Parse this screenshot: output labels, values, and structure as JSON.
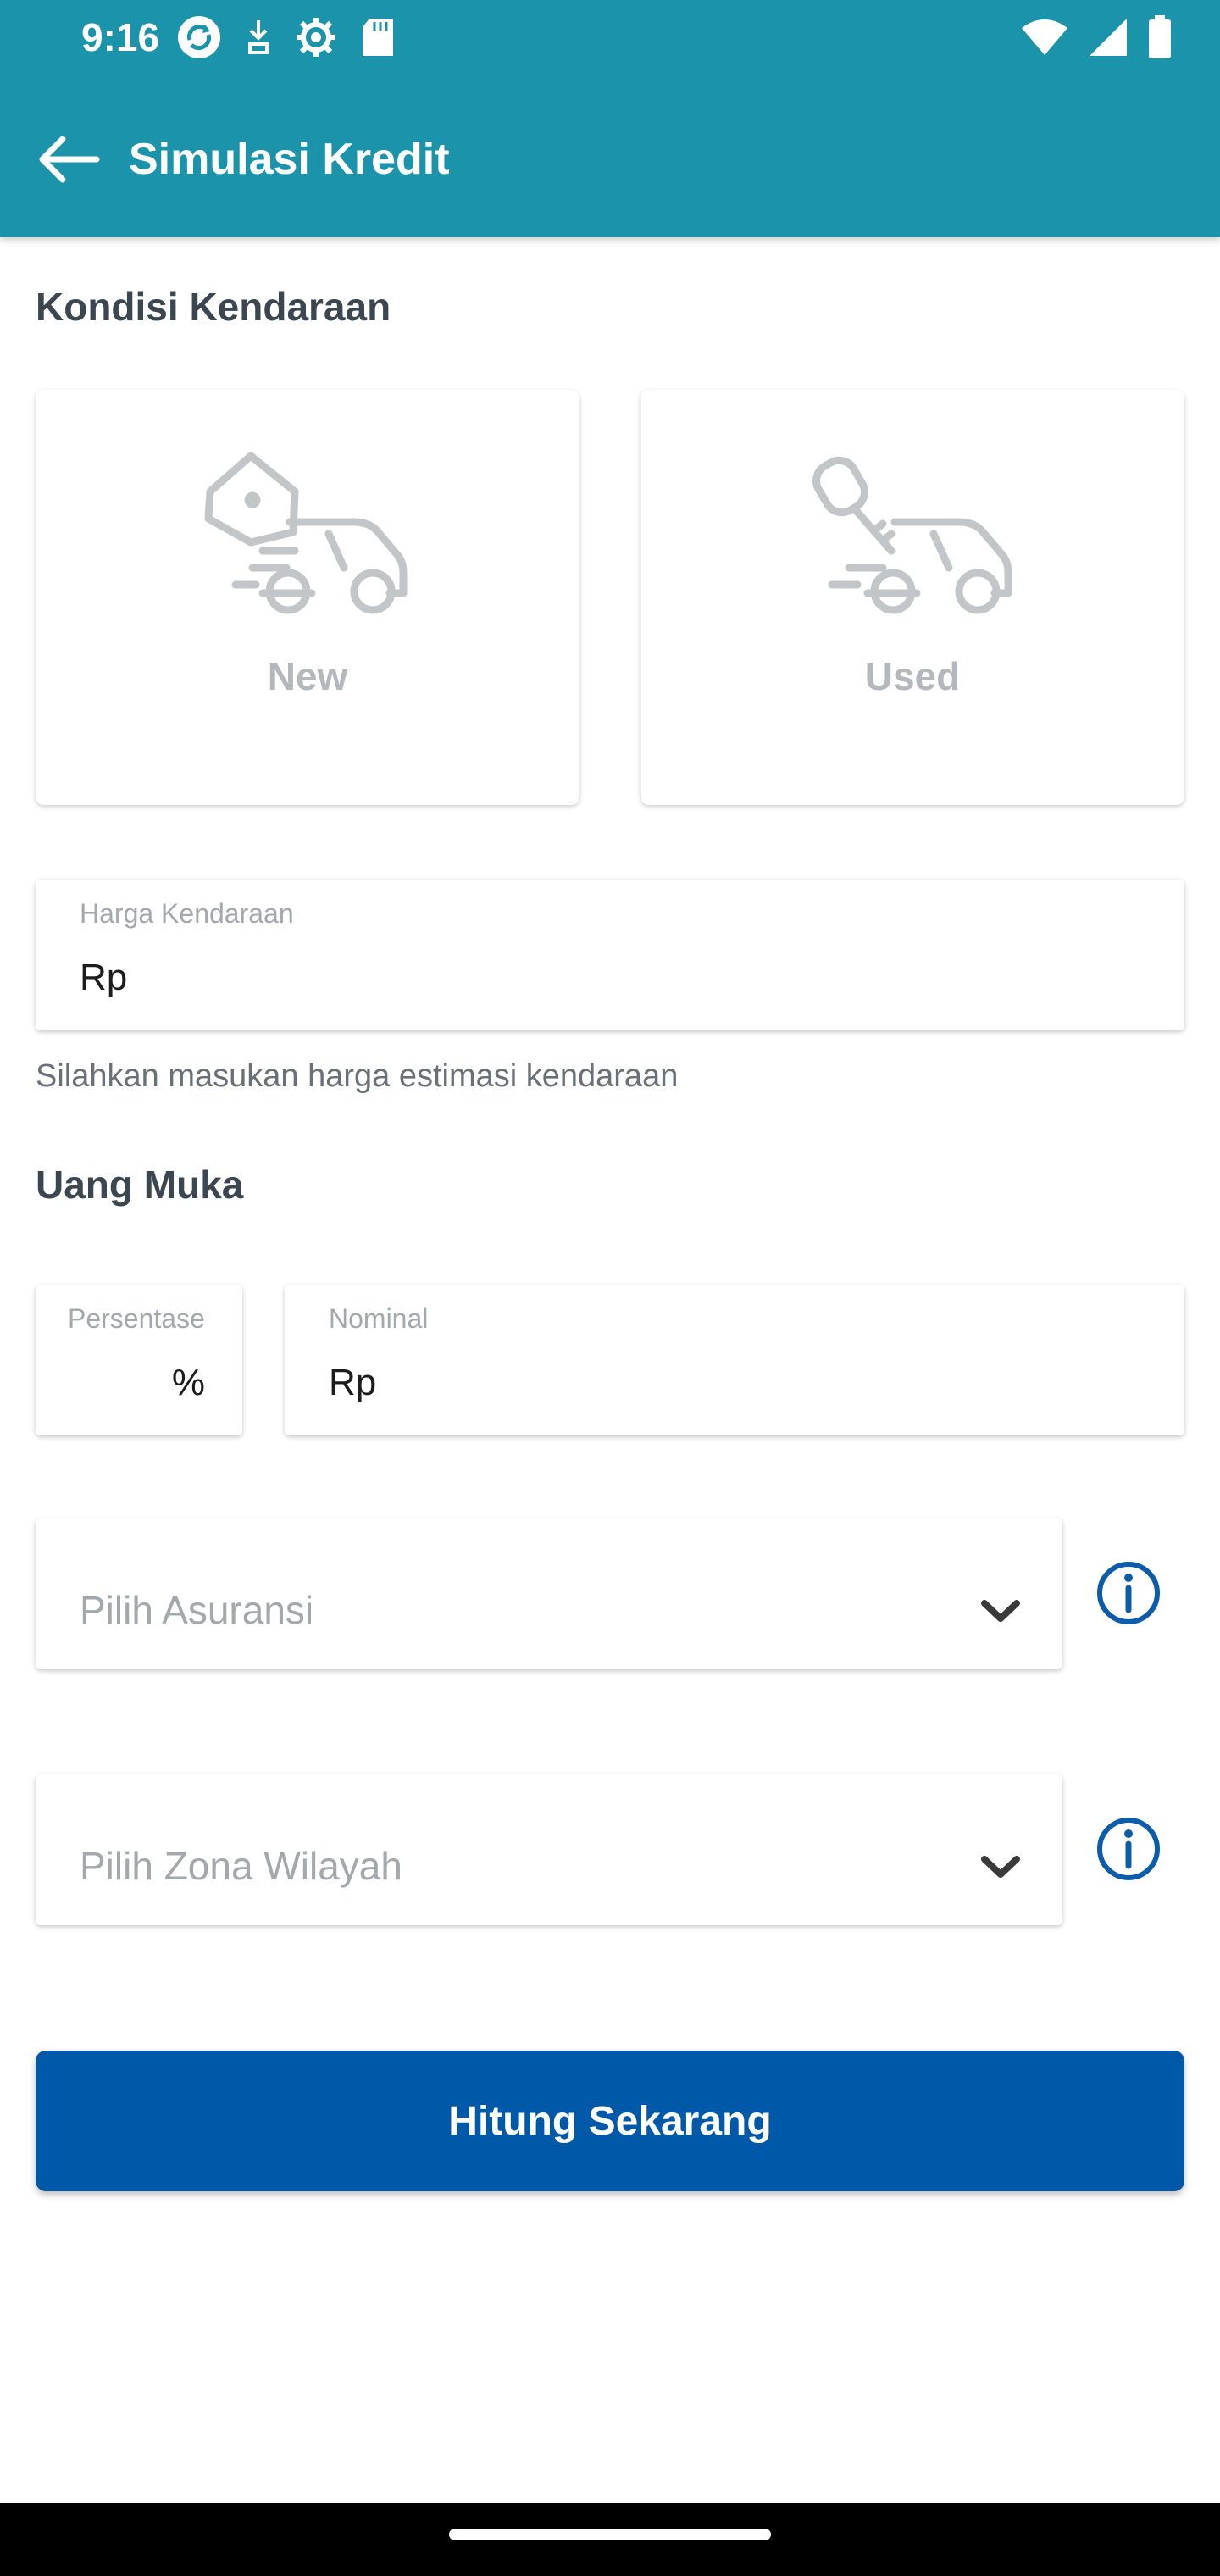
{
  "status_bar": {
    "time": "9:16",
    "left_icons": [
      "sync-icon",
      "download-icon",
      "settings-icon",
      "sd-card-icon"
    ],
    "right_icons": [
      "wifi-icon",
      "signal-icon",
      "battery-icon"
    ]
  },
  "appbar": {
    "title": "Simulasi Kredit",
    "back_icon": "arrow-left-icon",
    "color": "#1a93ab"
  },
  "vehicle_condition": {
    "title": "Kondisi Kendaraan",
    "options": [
      {
        "label": "New",
        "icon": "car-tag-icon"
      },
      {
        "label": "Used",
        "icon": "car-key-icon"
      }
    ]
  },
  "price_field": {
    "label": "Harga Kendaraan",
    "prefix": "Rp",
    "value": "",
    "helper": "Silahkan masukan harga estimasi kendaraan"
  },
  "down_payment": {
    "title": "Uang Muka",
    "percentage": {
      "label": "Persentase",
      "suffix": "%",
      "value": ""
    },
    "nominal": {
      "label": "Nominal",
      "prefix": "Rp",
      "value": ""
    }
  },
  "insurance_select": {
    "placeholder": "Pilih Asuransi",
    "info_icon": "info-icon"
  },
  "zone_select": {
    "placeholder": "Pilih Zona Wilayah",
    "info_icon": "info-icon"
  },
  "cta": {
    "label": "Hitung Sekarang",
    "color": "#0058a8"
  },
  "colors": {
    "accent": "#1a93ab",
    "primary_button": "#0058a8",
    "info_icon": "#0b5cab"
  }
}
